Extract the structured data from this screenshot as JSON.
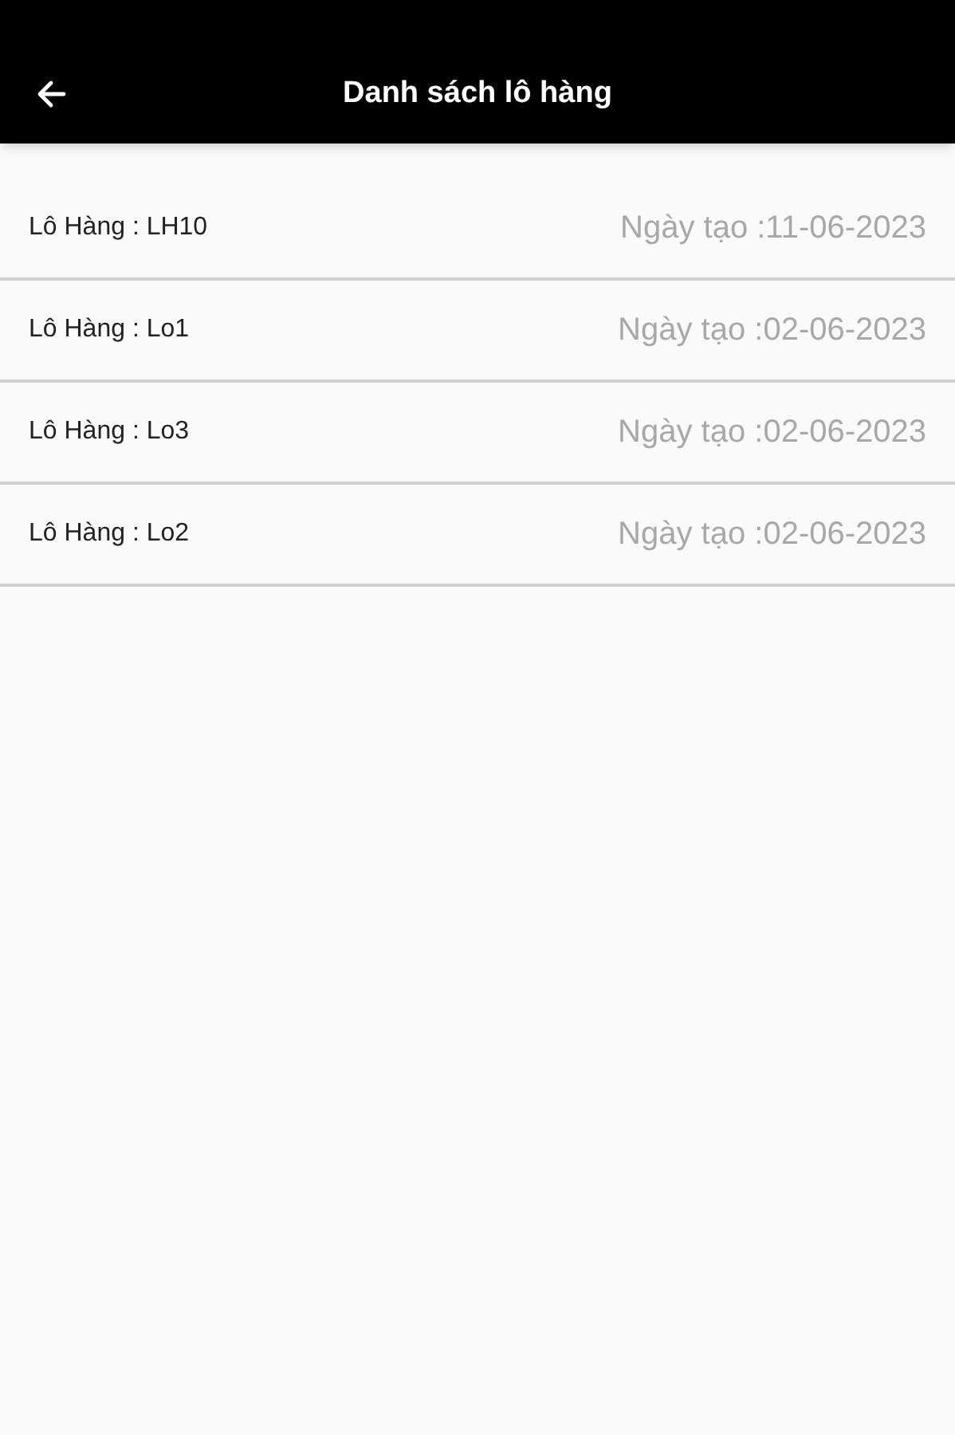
{
  "app_bar": {
    "title": "Danh sách lô hàng"
  },
  "shipments": [
    {
      "name": "Lô Hàng : LH10",
      "created": "Ngày tạo :11-06-2023"
    },
    {
      "name": "Lô Hàng : Lo1",
      "created": "Ngày tạo :02-06-2023"
    },
    {
      "name": "Lô Hàng : Lo3",
      "created": "Ngày tạo :02-06-2023"
    },
    {
      "name": "Lô Hàng : Lo2",
      "created": "Ngày tạo :02-06-2023"
    }
  ]
}
